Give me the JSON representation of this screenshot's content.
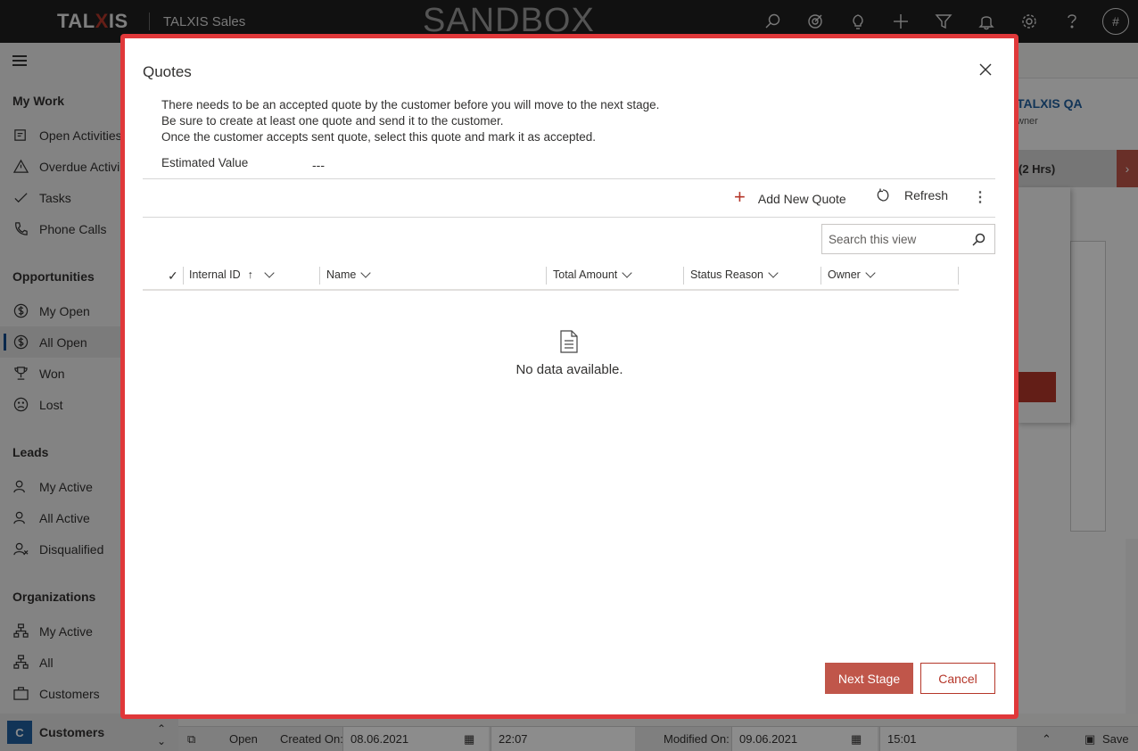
{
  "topbar": {
    "logo_pre": "TAL",
    "logo_x": "X",
    "logo_post": "IS",
    "app_name": "TALXIS Sales",
    "environment": "SANDBOX",
    "icons": [
      "search-icon",
      "target-icon",
      "lightbulb-icon",
      "plus-icon",
      "filter-icon",
      "bell-icon",
      "gear-icon",
      "help-icon"
    ],
    "avatar": "#"
  },
  "nav": {
    "groups": [
      {
        "title": "My Work",
        "items": [
          {
            "label": "Open Activities",
            "icon": "activities-icon"
          },
          {
            "label": "Overdue Activi",
            "icon": "warning-icon"
          },
          {
            "label": "Tasks",
            "icon": "task-icon"
          },
          {
            "label": "Phone Calls",
            "icon": "phone-icon"
          }
        ]
      },
      {
        "title": "Opportunities",
        "items": [
          {
            "label": "My Open",
            "icon": "dollar-icon"
          },
          {
            "label": "All Open",
            "icon": "dollar-icon",
            "active": true
          },
          {
            "label": "Won",
            "icon": "trophy-icon"
          },
          {
            "label": "Lost",
            "icon": "sad-icon"
          }
        ]
      },
      {
        "title": "Leads",
        "items": [
          {
            "label": "My Active",
            "icon": "person-icon"
          },
          {
            "label": "All Active",
            "icon": "person-icon"
          },
          {
            "label": "Disqualified",
            "icon": "person-x-icon"
          }
        ]
      },
      {
        "title": "Organizations",
        "items": [
          {
            "label": "My Active",
            "icon": "org-icon"
          },
          {
            "label": "All",
            "icon": "org-icon"
          },
          {
            "label": "Customers",
            "icon": "briefcase-icon"
          }
        ]
      }
    ],
    "area": {
      "badge": "C",
      "label": "Customers"
    }
  },
  "background": {
    "owner_name": "TALXIS QA",
    "owner_sub": "wner",
    "stage_label": "(2 Hrs)"
  },
  "footer": {
    "status": "Open",
    "created_label": "Created On:",
    "created_date": "08.06.2021",
    "created_time": "22:07",
    "modified_label": "Modified On:",
    "modified_date": "09.06.2021",
    "modified_time": "15:01",
    "save_label": "Save"
  },
  "dialog": {
    "title": "Quotes",
    "description": [
      "There needs to be an accepted quote by the customer before you will move to the next stage.",
      "Be sure to create at least one quote and send it to the customer.",
      "Once the customer accepts sent quote, select this quote and mark it as accepted."
    ],
    "estimated_label": "Estimated Value",
    "estimated_value": "---",
    "add_label": "Add New Quote",
    "refresh_label": "Refresh",
    "search_placeholder": "Search this view",
    "columns": [
      "Internal ID",
      "Name",
      "Total Amount",
      "Status Reason",
      "Owner"
    ],
    "empty_text": "No data available.",
    "next_label": "Next Stage",
    "cancel_label": "Cancel"
  }
}
